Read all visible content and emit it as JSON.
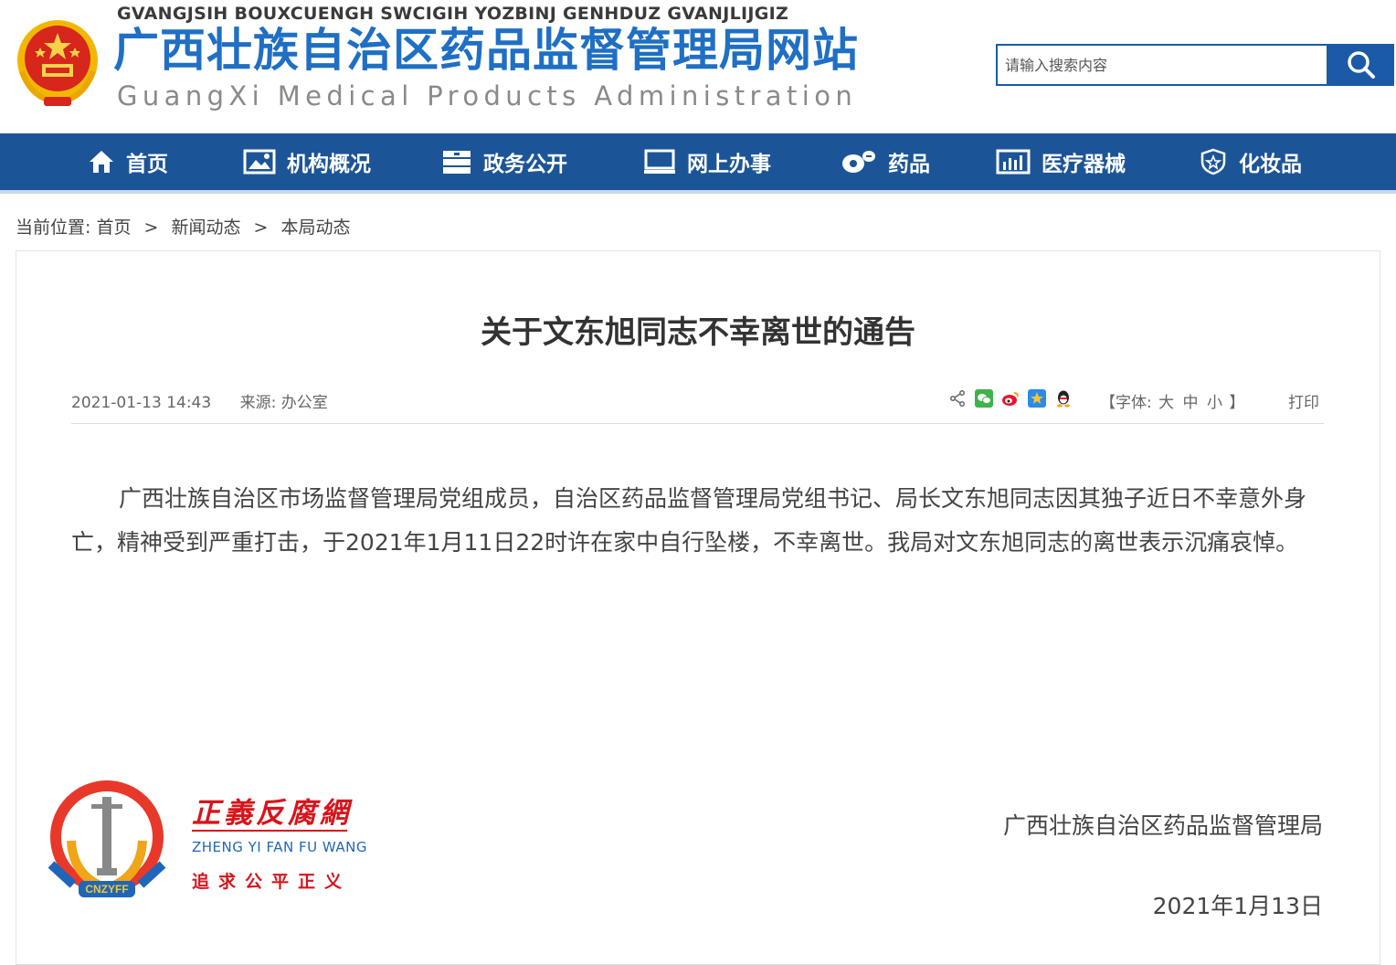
{
  "header": {
    "minority_name": "GVANGJSIH BOUXCUENGH SWCIGIH YOZBINJ GENHDUZ GVANJLIJGIZ",
    "site_title": "广西壮族自治区药品监督管理局网站",
    "site_title_en": "GuangXi  Medical  Products  Administration",
    "search": {
      "placeholder": "请输入搜索内容"
    }
  },
  "nav": {
    "items": [
      {
        "label": "首页",
        "icon": "home-icon"
      },
      {
        "label": "机构概况",
        "icon": "picture-icon"
      },
      {
        "label": "政务公开",
        "icon": "document-stack-icon"
      },
      {
        "label": "网上办事",
        "icon": "monitor-icon"
      },
      {
        "label": "药品",
        "icon": "pill-icon"
      },
      {
        "label": "医疗器械",
        "icon": "bar-chart-icon"
      },
      {
        "label": "化妆品",
        "icon": "shield-icon"
      }
    ],
    "bg_color": "#1c5597"
  },
  "breadcrumb": {
    "prefix": "当前位置:",
    "items": [
      "首页",
      "新闻动态",
      "本局动态"
    ],
    "separator": ">"
  },
  "article": {
    "title": "关于文东旭同志不幸离世的通告",
    "datetime": "2021-01-13 14:43",
    "source": "来源: 办公室",
    "font_size": {
      "prefix": "【字体:",
      "large": "大",
      "medium": "中",
      "small": "小",
      "suffix": "】"
    },
    "print": "打印",
    "share_icons": [
      "share-icon",
      "wechat-icon",
      "weibo-icon",
      "qzone-icon",
      "qq-icon"
    ],
    "body": "广西壮族自治区市场监督管理局党组成员，自治区药品监督管理局党组书记、局长文东旭同志因其独子近日不幸意外身亡，精神受到严重打击，于2021年1月11日22时许在家中自行坠楼，不幸离世。我局对文东旭同志的离世表示沉痛哀悼。",
    "signature": "广西壮族自治区药品监督管理局",
    "sign_date": "2021年1月13日"
  },
  "watermark": {
    "title": "正義反腐網",
    "pinyin": "ZHENG YI FAN FU WANG",
    "slogan": "追求公平正义",
    "emblem_text": "CNZYFF"
  },
  "colors": {
    "brand_blue": "#1f6fc4",
    "nav_blue": "#1c5597",
    "watermark_red": "#d8141b"
  }
}
